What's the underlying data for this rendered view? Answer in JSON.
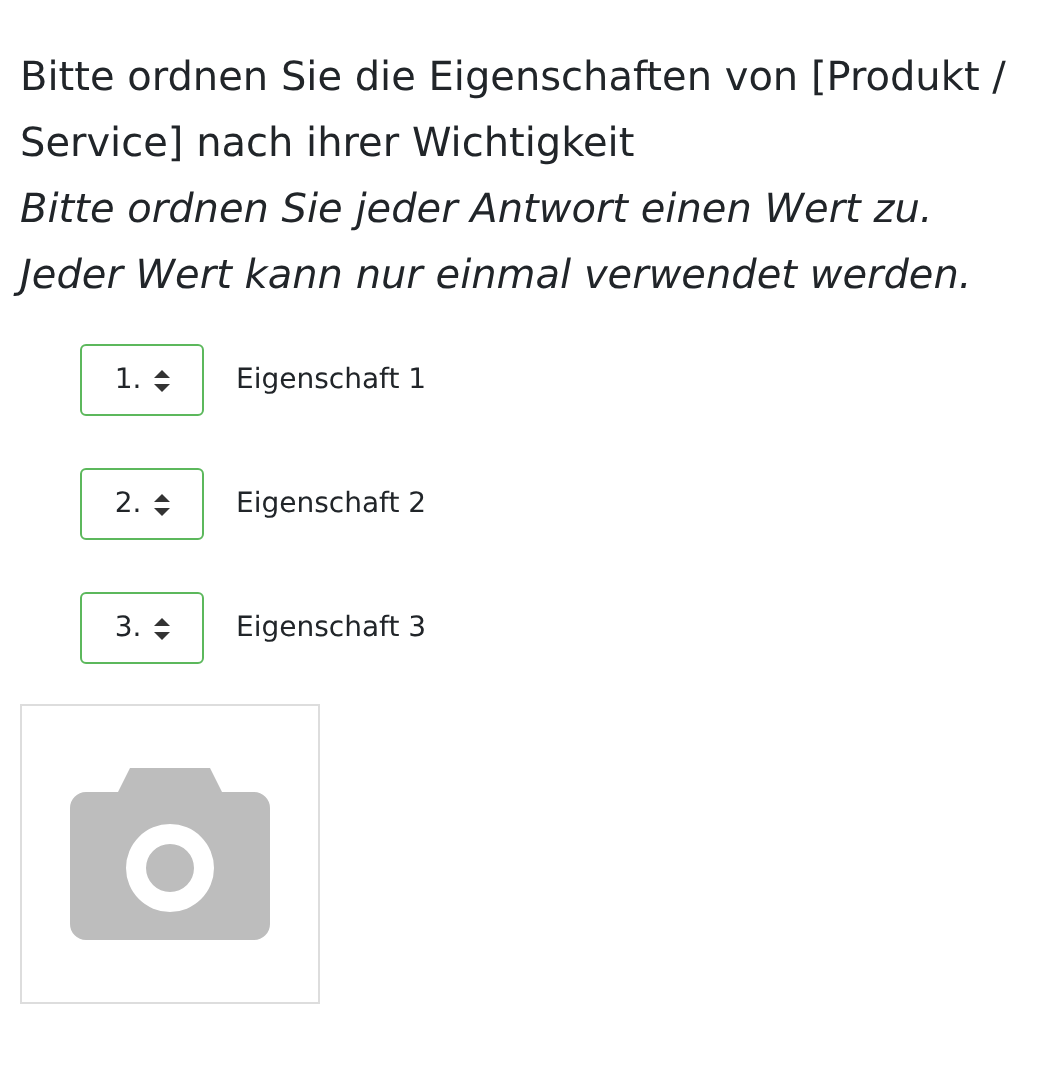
{
  "question": "Bitte ordnen Sie die Eigenschaften von [Produkt / Service] nach ihrer Wichtigkeit",
  "instructions": [
    "Bitte ordnen Sie jeder Antwort einen Wert zu.",
    "Jeder Wert kann nur einmal verwendet werden."
  ],
  "items": [
    {
      "rank": "1.",
      "label": "Eigenschaft 1"
    },
    {
      "rank": "2.",
      "label": "Eigenschaft 2"
    },
    {
      "rank": "3.",
      "label": "Eigenschaft 3"
    }
  ],
  "image": {
    "kind": "placeholder"
  }
}
